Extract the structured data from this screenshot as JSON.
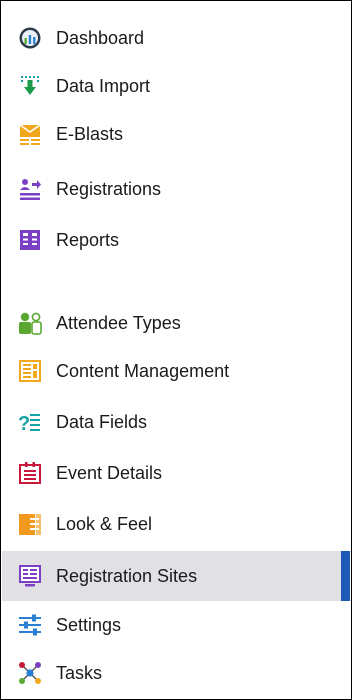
{
  "sidebar": {
    "items": [
      {
        "label": "Dashboard",
        "icon": "dashboard-gauge-icon"
      },
      {
        "label": "Data Import",
        "icon": "data-import-icon"
      },
      {
        "label": "E-Blasts",
        "icon": "envelope-icon"
      },
      {
        "label": "Registrations",
        "icon": "registrations-icon"
      },
      {
        "label": "Reports",
        "icon": "reports-icon"
      },
      {
        "label": "Attendee Types",
        "icon": "attendee-types-icon"
      },
      {
        "label": "Content Management",
        "icon": "content-management-icon"
      },
      {
        "label": "Data Fields",
        "icon": "data-fields-icon"
      },
      {
        "label": "Event Details",
        "icon": "event-details-icon"
      },
      {
        "label": "Look & Feel",
        "icon": "look-and-feel-icon"
      },
      {
        "label": "Registration Sites",
        "icon": "registration-sites-icon",
        "active": true
      },
      {
        "label": "Settings",
        "icon": "settings-sliders-icon"
      },
      {
        "label": "Tasks",
        "icon": "tasks-network-icon"
      }
    ]
  },
  "colors": {
    "active_background": "#e1e1e5",
    "active_indicator": "#1e5bb8",
    "text": "#1a1a1a"
  }
}
